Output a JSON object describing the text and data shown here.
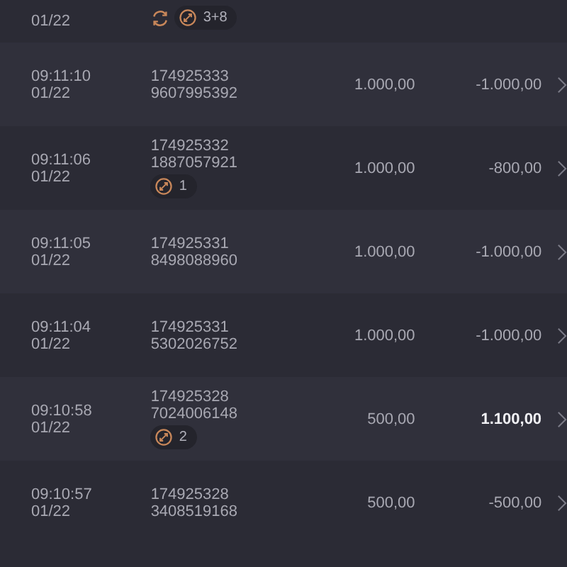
{
  "rows": [
    {
      "kind": "cut",
      "date": "01/22",
      "tags": [
        {
          "kind": "refresh"
        },
        {
          "kind": "circle",
          "label": "3+8"
        }
      ]
    },
    {
      "kind": "full",
      "time": "09:11:10",
      "date": "01/22",
      "id_line1": "174925333",
      "id_line2": "9607995392",
      "amount": "1.000,00",
      "result": "-1.000,00",
      "emphasized": false,
      "tags": []
    },
    {
      "kind": "full",
      "time": "09:11:06",
      "date": "01/22",
      "id_line1": "174925332",
      "id_line2": "1887057921",
      "amount": "1.000,00",
      "result": "-800,00",
      "emphasized": false,
      "tags": [
        {
          "kind": "circle",
          "label": "1"
        }
      ]
    },
    {
      "kind": "full",
      "time": "09:11:05",
      "date": "01/22",
      "id_line1": "174925331",
      "id_line2": "8498088960",
      "amount": "1.000,00",
      "result": "-1.000,00",
      "emphasized": false,
      "tags": []
    },
    {
      "kind": "full",
      "time": "09:11:04",
      "date": "01/22",
      "id_line1": "174925331",
      "id_line2": "5302026752",
      "amount": "1.000,00",
      "result": "-1.000,00",
      "emphasized": false,
      "tags": []
    },
    {
      "kind": "full",
      "time": "09:10:58",
      "date": "01/22",
      "id_line1": "174925328",
      "id_line2": "7024006148",
      "amount": "500,00",
      "result": "1.100,00",
      "emphasized": true,
      "tags": [
        {
          "kind": "circle",
          "label": "2"
        }
      ]
    },
    {
      "kind": "full",
      "time": "09:10:57",
      "date": "01/22",
      "id_line1": "174925328",
      "id_line2": "3408519168",
      "amount": "500,00",
      "result": "-500,00",
      "emphasized": false,
      "tags": []
    }
  ]
}
